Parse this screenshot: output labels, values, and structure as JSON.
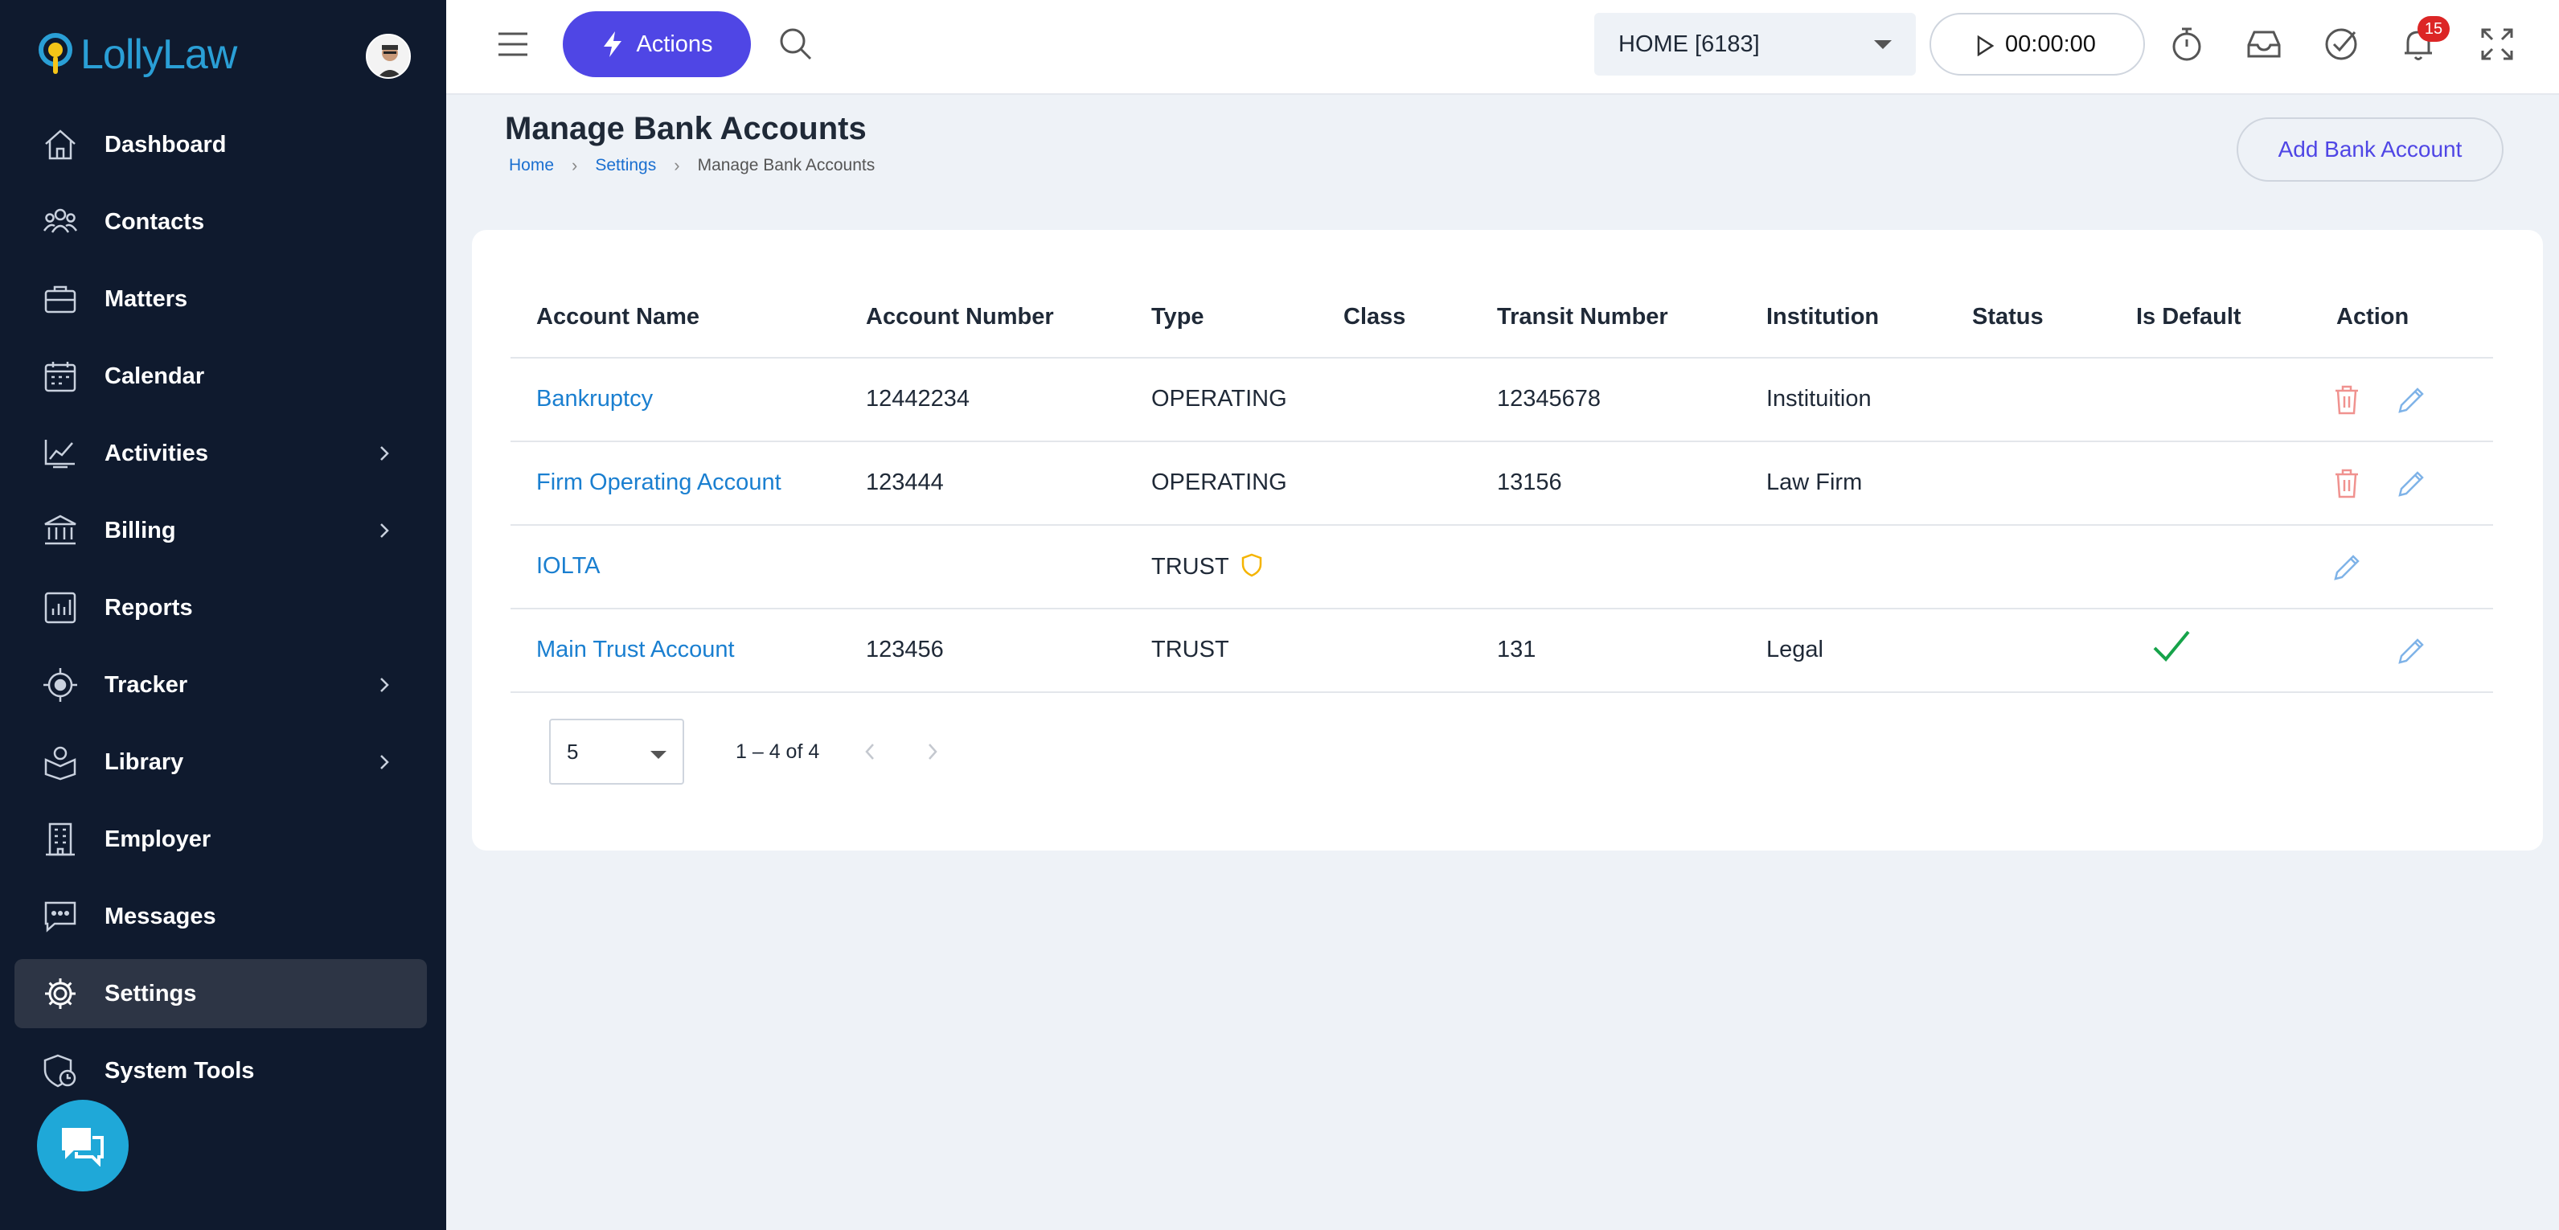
{
  "app": {
    "name": "LollyLaw"
  },
  "sidebar": {
    "items": [
      {
        "label": "Dashboard",
        "icon": "home-icon",
        "expandable": false
      },
      {
        "label": "Contacts",
        "icon": "people-icon",
        "expandable": false
      },
      {
        "label": "Matters",
        "icon": "briefcase-icon",
        "expandable": false
      },
      {
        "label": "Calendar",
        "icon": "calendar-icon",
        "expandable": false
      },
      {
        "label": "Activities",
        "icon": "activity-chart-icon",
        "expandable": true
      },
      {
        "label": "Billing",
        "icon": "bank-icon",
        "expandable": true
      },
      {
        "label": "Reports",
        "icon": "reports-icon",
        "expandable": false
      },
      {
        "label": "Tracker",
        "icon": "target-icon",
        "expandable": true
      },
      {
        "label": "Library",
        "icon": "library-icon",
        "expandable": true
      },
      {
        "label": "Employer",
        "icon": "building-icon",
        "expandable": false
      },
      {
        "label": "Messages",
        "icon": "message-icon",
        "expandable": false
      },
      {
        "label": "Settings",
        "icon": "gear-icon",
        "expandable": false,
        "active": true
      },
      {
        "label": "System Tools",
        "icon": "shield-clock-icon",
        "expandable": false
      }
    ]
  },
  "topbar": {
    "actions_label": "Actions",
    "workspace_select": "HOME [6183]",
    "timer": "00:00:00",
    "notification_count": "15"
  },
  "page": {
    "title": "Manage Bank Accounts",
    "breadcrumb": [
      "Home",
      "Settings",
      "Manage Bank Accounts"
    ],
    "add_button": "Add Bank Account"
  },
  "table": {
    "columns": [
      "Account Name",
      "Account Number",
      "Type",
      "Class",
      "Transit Number",
      "Institution",
      "Status",
      "Is Default",
      "Action"
    ],
    "rows": [
      {
        "name": "Bankruptcy",
        "number": "12442234",
        "type": "OPERATING",
        "class": "",
        "transit": "12345678",
        "institution": "Instituition",
        "status": "",
        "is_default": false,
        "can_delete": true
      },
      {
        "name": "Firm Operating Account",
        "number": "123444",
        "type": "OPERATING",
        "class": "",
        "transit": "13156",
        "institution": "Law Firm",
        "status": "",
        "is_default": false,
        "can_delete": true
      },
      {
        "name": "IOLTA",
        "number": "",
        "type": "TRUST",
        "class": "",
        "transit": "",
        "institution": "",
        "status": "",
        "is_default": false,
        "can_delete": false,
        "type_badge": "shield-icon"
      },
      {
        "name": "Main Trust Account",
        "number": "123456",
        "type": "TRUST",
        "class": "",
        "transit": "131",
        "institution": "Legal",
        "status": "",
        "is_default": true,
        "can_delete": false
      }
    ]
  },
  "pagination": {
    "page_size": "5",
    "range": "1 – 4 of 4"
  },
  "colors": {
    "sidebar_bg": "#0f1a2e",
    "accent": "#4f46e5",
    "link": "#1a7fd0",
    "delete": "#f0928f",
    "check": "#16a34a",
    "badge": "#dc2626"
  }
}
